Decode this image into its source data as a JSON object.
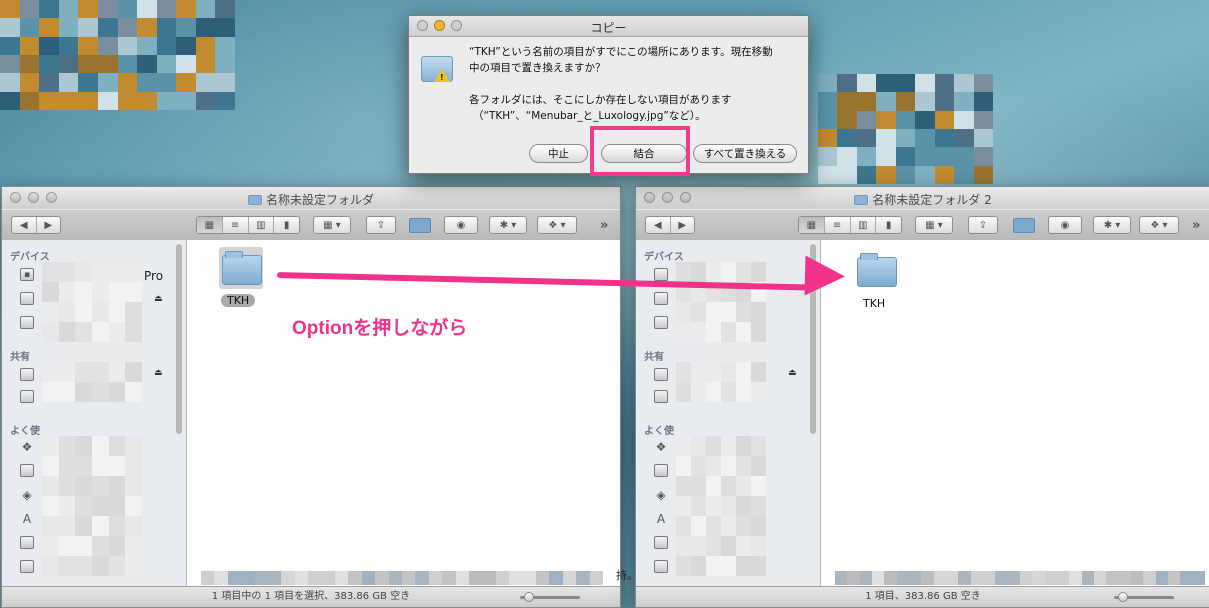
{
  "dialog": {
    "title": "コピー",
    "message_line1": "“TKH”という名前の項目がすでにこの場所にあります。現在移動",
    "message_line2": "中の項目で置き換えますか？",
    "detail_line1": "各フォルダには、そこにしか存在しない項目があります",
    "detail_line2": "（“TKH”、“Menubar_と_Luxology.jpg”など）。",
    "buttons": {
      "stop": "中止",
      "merge": "結合",
      "replace_all": "すべて置き換える"
    },
    "highlight_color": "#ee3d8a"
  },
  "left_window": {
    "title": "名称未設定フォルダ",
    "sidebar": {
      "devices_header": "デバイス",
      "shared_header": "共有",
      "favorites_header": "よく使",
      "device_suffix": "Pro"
    },
    "item_label": "TKH",
    "status_text": "1 項目中の 1 項目を選択、383.86 GB 空き"
  },
  "right_window": {
    "title": "名称未設定フォルダ 2",
    "sidebar": {
      "devices_header": "デバイス",
      "shared_header": "共有",
      "favorites_header": "よく使"
    },
    "item_label": "TKH",
    "status_text": "1 項目、383.86 GB 空き",
    "cut_text": "持。"
  },
  "annotation": {
    "text": "Optionを押しながら",
    "color": "#f0328a"
  },
  "toolbar_icons": [
    "back-icon",
    "forward-icon",
    "icon-view-icon",
    "list-view-icon",
    "column-view-icon",
    "coverflow-view-icon",
    "arrange-icon",
    "share-icon",
    "folder-icon",
    "quicklook-icon",
    "gear-icon",
    "dropbox-icon",
    "more-icon"
  ]
}
